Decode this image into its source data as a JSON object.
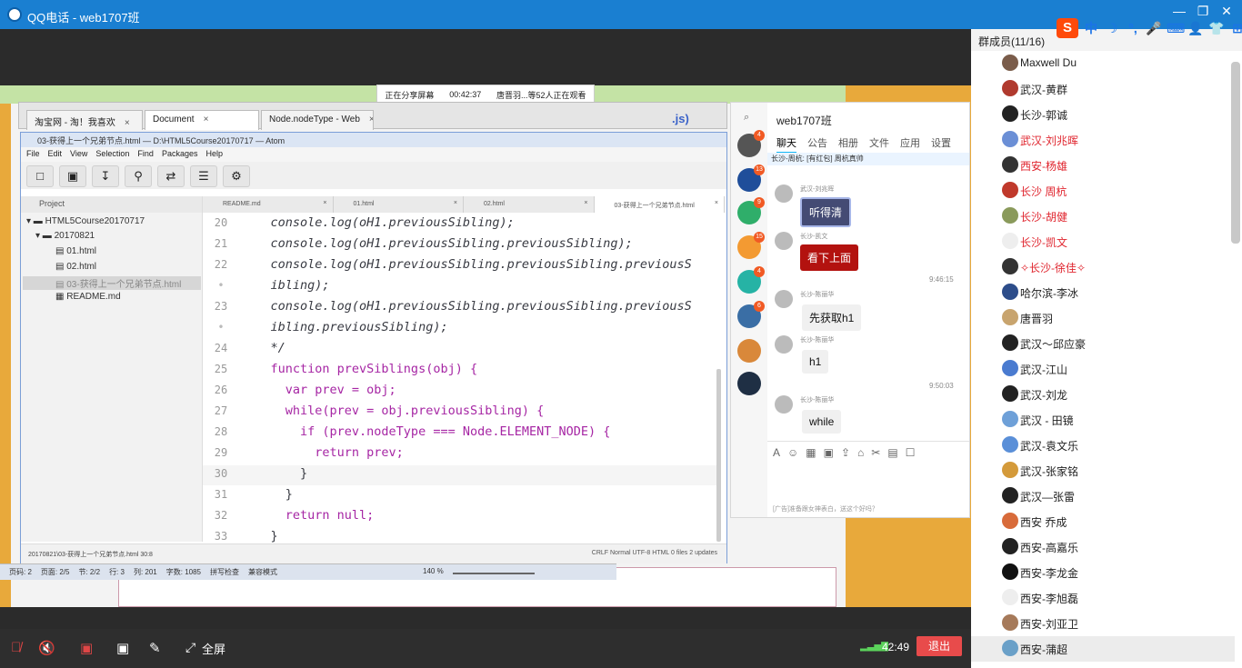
{
  "window": {
    "title": "QQ电话 - web1707班"
  },
  "ime": {
    "logo": "S",
    "items": [
      "中",
      "☽",
      "°,",
      "🎤",
      "⌨",
      "👤",
      "👕",
      "⊞"
    ]
  },
  "window_buttons": [
    "—",
    "❐",
    "✕"
  ],
  "share_note": {
    "status": "正在分享屏幕",
    "timer": "00:42:37",
    "viewers": "唐晋羽...等52人正在观看"
  },
  "browser": {
    "tabs": [
      {
        "label": "淘宝网 - 淘！我喜欢",
        "active": false
      },
      {
        "label": "Document",
        "active": true
      },
      {
        "label": "Node.nodeType - Web",
        "active": false
      }
    ],
    "partial_text": ".js)"
  },
  "atom": {
    "title": "03-获得上一个兄弟节点.html — D:\\HTML5Course20170717 — Atom",
    "menu": [
      "File",
      "Edit",
      "View",
      "Selection",
      "Find",
      "Packages",
      "Help"
    ],
    "toolbar_icons": [
      "file-icon",
      "folder-icon",
      "save-icon",
      "search-icon",
      "shuffle-icon",
      "menu-icon",
      "gear-icon"
    ],
    "tree": {
      "header": "Project",
      "root": "HTML5Course20170717",
      "folder": "20170821",
      "files": [
        "01.html",
        "02.html",
        "03-获得上一个兄弟节点.html",
        "README.md"
      ]
    },
    "editor_tabs": [
      "README.md",
      "01.html",
      "02.html",
      "03-获得上一个兄弟节点.html"
    ],
    "code": [
      {
        "ln": "20",
        "text": "    console.log(oH1.previousSibling);"
      },
      {
        "ln": "21",
        "text": "    console.log(oH1.previousSibling.previousSibling);"
      },
      {
        "ln": "22",
        "text": "    console.log(oH1.previousSibling.previousSibling.previousS"
      },
      {
        "ln": "•",
        "text": "    ibling);"
      },
      {
        "ln": "23",
        "text": "    console.log(oH1.previousSibling.previousSibling.previousS"
      },
      {
        "ln": "•",
        "text": "    ibling.previousSibling);"
      },
      {
        "ln": "24",
        "text": "    */"
      },
      {
        "ln": "25",
        "text": "    function prevSiblings(obj) {"
      },
      {
        "ln": "26",
        "text": "      var prev = obj;"
      },
      {
        "ln": "27",
        "text": "      while(prev = obj.previousSibling) {"
      },
      {
        "ln": "28",
        "text": "        if (prev.nodeType === Node.ELEMENT_NODE) {"
      },
      {
        "ln": "29",
        "text": "          return prev;"
      },
      {
        "ln": "30",
        "text": "        }"
      },
      {
        "ln": "31",
        "text": "      }"
      },
      {
        "ln": "32",
        "text": "      return null;"
      },
      {
        "ln": "33",
        "text": "    }"
      }
    ],
    "status_left": "20170821\\03-获得上一个兄弟节点.html  30:8",
    "status_right": "CRLF   Normal   UTF-8   HTML   0 files   2 updates"
  },
  "wordbar": {
    "items": [
      "页码: 2",
      "页面: 2/5",
      "节: 2/2",
      "行: 3",
      "列: 201",
      "字数: 1085",
      "拼写检查",
      "兼容模式"
    ],
    "zoom": "140 %"
  },
  "chat": {
    "group_name": "web1707班",
    "tabs": [
      "聊天",
      "公告",
      "相册",
      "文件",
      "应用",
      "设置"
    ],
    "active_tab": "聊天",
    "notice": "长沙-周杭: [有红包] 周杭真帅",
    "rail_badges": [
      "4",
      "13",
      "9",
      "",
      "15",
      "4",
      "6",
      "",
      ""
    ],
    "messages": [
      {
        "name": "武汉-刘兆晖",
        "text": "听得清",
        "style": "dark"
      },
      {
        "name": "长沙-凯文",
        "text": "看下上面",
        "style": "red"
      },
      {
        "time": "9:46:15"
      },
      {
        "name": "长沙-陈丽华",
        "text": "先获取h1",
        "style": "plain"
      },
      {
        "name": "长沙-陈丽华",
        "text": "h1",
        "style": "plain"
      },
      {
        "time": "9:50:03"
      },
      {
        "name": "长沙-陈丽华",
        "text": "while",
        "style": "plain"
      }
    ],
    "toolbar_icons": [
      "A",
      "☺",
      "▦",
      "▣",
      "⇪",
      "⌂",
      "✂",
      "▤",
      "☐"
    ],
    "ad": "[广告]准备跟女神表白，送这个好吗？"
  },
  "members": {
    "header": "群成员(11/16)",
    "list": [
      {
        "name": "Maxwell Du",
        "color": "#222222"
      },
      {
        "name": "武汉-黄群",
        "color": "#222222"
      },
      {
        "name": "长沙-郭诚",
        "color": "#222222"
      },
      {
        "name": "武汉-刘兆晖",
        "color": "#e0262f"
      },
      {
        "name": "西安-杨雄",
        "color": "#e0262f"
      },
      {
        "name": "长沙 周杭",
        "color": "#e0262f"
      },
      {
        "name": "长沙-胡健",
        "color": "#e0262f"
      },
      {
        "name": "长沙-凯文",
        "color": "#e0262f"
      },
      {
        "name": "✧长沙-徐佳✧",
        "color": "#e0262f"
      },
      {
        "name": "哈尔滨-李冰",
        "color": "#222222"
      },
      {
        "name": "唐晋羽",
        "color": "#222222"
      },
      {
        "name": "武汉～邱应豪",
        "color": "#222222"
      },
      {
        "name": "武汉-江山",
        "color": "#222222"
      },
      {
        "name": "武汉-刘龙",
        "color": "#222222"
      },
      {
        "name": "武汉 - 田镜",
        "color": "#222222"
      },
      {
        "name": "武汉-袁文乐",
        "color": "#222222"
      },
      {
        "name": "武汉-张家铭",
        "color": "#222222"
      },
      {
        "name": "武汉—张雷",
        "color": "#222222"
      },
      {
        "name": "西安 乔成",
        "color": "#222222"
      },
      {
        "name": "西安-高嘉乐",
        "color": "#222222"
      },
      {
        "name": "西安-李龙金",
        "color": "#222222"
      },
      {
        "name": "西安-李旭磊",
        "color": "#222222"
      },
      {
        "name": "西安-刘亚卫",
        "color": "#222222"
      },
      {
        "name": "西安-蒲超",
        "color": "#222222"
      }
    ]
  },
  "controls": {
    "fullscreen_label": "全屏",
    "time": "42:49",
    "exit_label": "退出"
  }
}
